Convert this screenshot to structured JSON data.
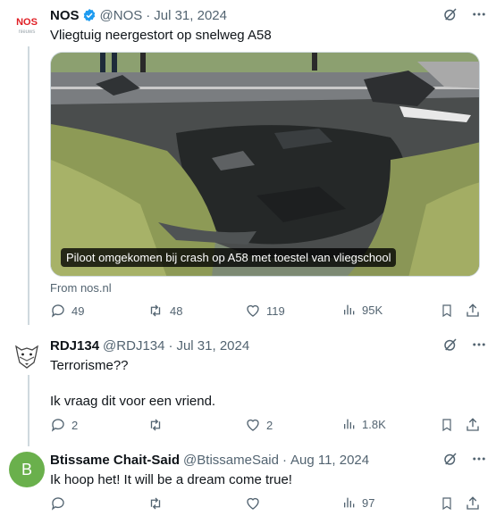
{
  "tweets": [
    {
      "name": "NOS",
      "avatar_brand": "NOS",
      "avatar_sub": "nieuws",
      "handle": "@NOS",
      "date": "Jul 31, 2024",
      "text": "Vliegtuig neergestort op snelweg A58",
      "card_caption": "Piloot omgekomen bij crash op A58 met toestel van vliegschool",
      "card_source": "From nos.nl",
      "replies": "49",
      "reposts": "48",
      "likes": "119",
      "views": "95K"
    },
    {
      "name": "RDJ134",
      "handle": "@RDJ134",
      "date": "Jul 31, 2024",
      "text": "Terrorisme??\n\nIk vraag dit voor een vriend.",
      "replies": "2",
      "reposts": "",
      "likes": "2",
      "views": "1.8K"
    },
    {
      "name": "Btissame Chait-Said",
      "avatar_letter": "B",
      "handle": "@BtissameSaid",
      "date": "Aug 11, 2024",
      "text": "Ik hoop het! It will be a dream come true!",
      "replies": "",
      "reposts": "",
      "likes": "",
      "views": "97"
    }
  ],
  "icons": [
    "verified-badge-icon",
    "grok-icon",
    "more-icon",
    "reply-icon",
    "repost-icon",
    "like-icon",
    "views-icon",
    "bookmark-icon",
    "share-icon"
  ],
  "colors": {
    "accent": "#1d9bf0",
    "muted": "#536471",
    "nos_red": "#e01e24",
    "avatar_green": "#6ab04c"
  }
}
